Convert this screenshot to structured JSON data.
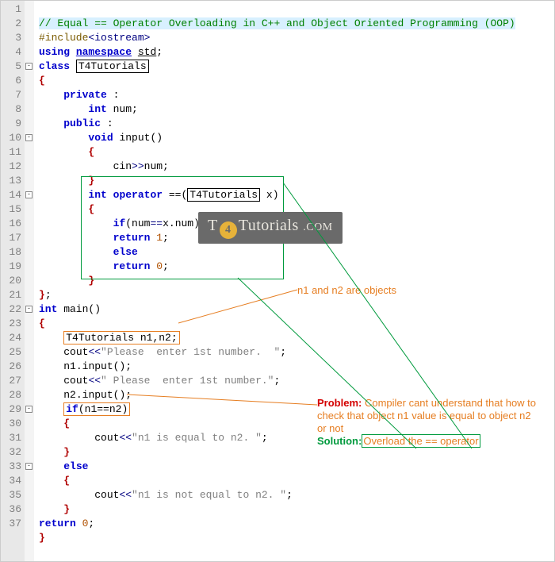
{
  "lines": {
    "count": 37,
    "l1": "// Equal == Operator Overloading in C++ and Object Oriented Programming (OOP)",
    "l2_inc": "#include",
    "l2_hdr": "<iostream>",
    "l3_using": "using",
    "l3_ns": "namespace",
    "l3_std": "std",
    "l4_class": "class",
    "l4_name": "T4Tutorials",
    "l6_private": "private",
    "l7_int": "int",
    "l7_num": " num",
    "l8_public": "public",
    "l9_void": "void",
    "l9_input": " input",
    "l11_cin": "cin",
    "l11_num": "num",
    "l13_int": "int",
    "l13_op": "operator",
    "l13_eq": " ==",
    "l13_type": "T4Tutorials",
    "l13_x": " x",
    "l15_if": "if",
    "l15_cond_a": "num",
    "l15_cond_b": "x",
    "l15_cond_c": "num",
    "l16_ret": "return",
    "l16_v": " 1",
    "l17_else": "else",
    "l18_ret": "return",
    "l18_v": " 0",
    "l21_int": "int",
    "l21_main": " main",
    "l23_type": "T4Tutorials",
    "l23_vars": " n1,n2;",
    "l24_cout": "cout",
    "l24_s": "\"Please  enter 1st number.  \"",
    "l25_a": "n1",
    "l25_b": "input",
    "l26_cout": "cout",
    "l26_s": "\" Please  enter 1st number.\"",
    "l27_a": "n2",
    "l27_b": "input",
    "l28_if": "if",
    "l28_cond": "n1==n2",
    "l30_cout": "cout",
    "l30_s": "\"n1 is equal to n2. \"",
    "l32_else": "else",
    "l34_cout": "cout",
    "l34_s": "\"n1 is not equal to n2. \"",
    "l36_ret": "return",
    "l36_v": " 0"
  },
  "fold_rows": [
    5,
    10,
    14,
    22,
    29,
    33
  ],
  "annotations": {
    "objects_label": "n1 and n2 are objects",
    "problem_label": "Problem:",
    "problem_text": " Compiler cant understand that how to check that object n1 value is equal to object n2 or not",
    "solution_label": "Solution:",
    "solution_text": "Overload the == operator"
  },
  "watermark": {
    "pre": "T",
    "num": "4",
    "post": "Tutorials",
    "suffix": ".COM"
  }
}
